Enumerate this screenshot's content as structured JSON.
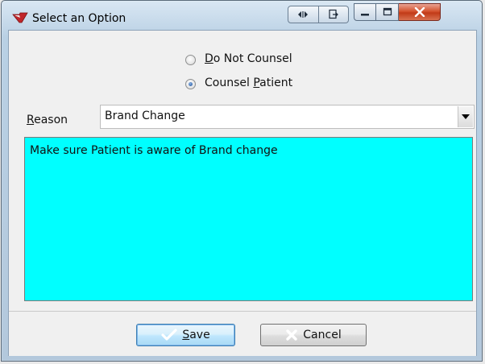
{
  "window": {
    "title": "Select an Option"
  },
  "options": [
    {
      "label_mn": "D",
      "label_rest": "o Not Counsel",
      "checked": false
    },
    {
      "label_pre": "Counsel ",
      "label_mn": "P",
      "label_rest": "atient",
      "checked": true
    }
  ],
  "reason": {
    "label_mn": "R",
    "label_rest": "eason",
    "selected": "Brand Change"
  },
  "note": {
    "text": "Make sure Patient is aware of Brand change"
  },
  "buttons": {
    "save_mn": "S",
    "save_rest": "ave",
    "cancel": "Cancel"
  },
  "colors": {
    "note_background": "#00ffff",
    "title_bar": "#c6d9ea"
  },
  "icons": [
    "app-icon",
    "resize-icon",
    "restore-icon",
    "minimize-icon",
    "maximize-icon",
    "close-icon",
    "dropdown-arrow-icon",
    "checkmark-icon",
    "cancel-x-icon"
  ]
}
